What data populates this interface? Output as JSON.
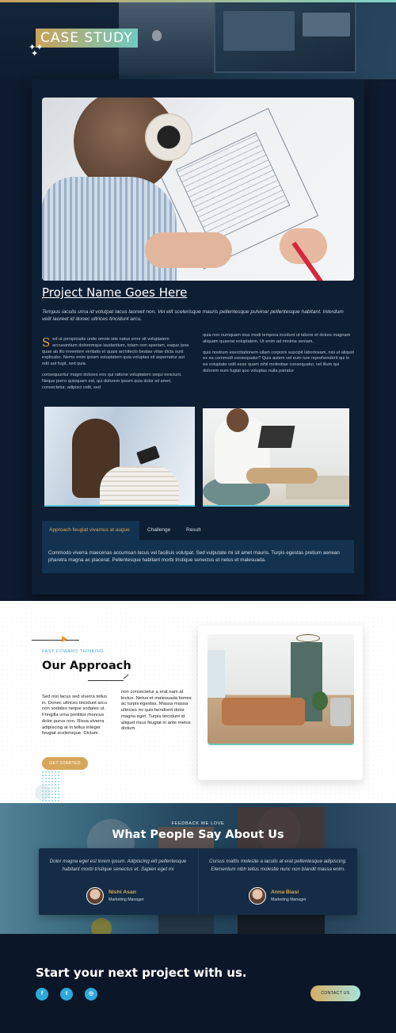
{
  "hero": {
    "title": "CASE STUDY",
    "sparkle": "+ +\n +"
  },
  "project": {
    "title": "Project Name Goes Here",
    "intro": "Tempus iaculis urna id volutpat lacus laoreet non. Vel elit scelerisque mauris pellentesque pulvinar pellentesque habitant. Interdum velit laoreet id donec ultrices tincidunt arcu.",
    "dropcap": "S",
    "left_p1": "ed ut perspiciatis unde omnis iste natus error sit voluptatem accusantium doloremque laudantium, totam rem aperiam, eaque ipsa quae ab illo inventore veritatis et quasi architecto beatae vitae dicta sunt explicabo. Nemo enim ipsam voluptatem quia voluptas sit aspernatur aut odit aut fugit, sed quia.",
    "left_p2": "consequuntur magni dolores eos qui ratione voluptatem sequi nesciunt. Neque porro quisquam est, qui dolorem ipsum quia dolor sit amet, consectetur, adipisci velit, sed",
    "right_p1": "quia non numquam eius modi tempora incidunt ut labore et dolore magnam aliquam quaerat voluptatem. Ut enim ad minima veniam,",
    "right_p2": "quis nostrum exercitationem ullam corporis suscipit laboriosam, nisi ut aliquid ex ea commodi consequatur? Quis autem vel eum iure reprehenderit qui in ea voluptate velit esse quam nihil molestiae consequatur, vel illum qui dolorem eum fugiat quo voluptas nulla pariatur",
    "tabs": [
      {
        "label": "Approach feugiat vivamus at augue"
      },
      {
        "label": "Challenge"
      },
      {
        "label": "Result"
      }
    ],
    "tab_content": "Commodo viverra maecenas accumsan lacus vel facilisis volutpat. Sed vulputate mi sit amet mauris. Turpis egestas pretium aenean pharetra magna ac placerat. Pellentesque habitant morbi tristique senectus et netus et malesuada."
  },
  "approach": {
    "kicker": "FAST FOWARD THINKING",
    "title": "Our Approach",
    "left_text": "Sed nisi lacus sed viverra tellus in. Donec ultrices tincidunt arcu non sodales neque sodales ut. Fringilla urna porttitor rhoncus dolor purus non. Risus viverra adipiscing at in tellus integer feugiat scelerisque. Dictum",
    "right_text": "non consectetur a erat nam at lectus. Netus et malesuada fames ac turpis egestas. Massa massa ultricies mi quis hendrerit dolor magna eget. Turpis tincidunt id aliquet risus feugiat in ante metus dictum.",
    "button": "GET STARTED"
  },
  "testimonials": {
    "kicker": "FEEDBACK WE LOVE",
    "title": "What People Say About Us",
    "items": [
      {
        "quote": "Dolor magna eget est lorem ipsum. Adipiscing elit pellentesque habitant morbi tristique senectus et. Sapien eget mi",
        "name": "Nishi Asan",
        "role": "Marketing Manager"
      },
      {
        "quote": "Cursus mattis molestie a iaculis at erat pellentesque adipiscing. Elementum nibh tellus molestie nunc non blandit massa enim.",
        "name": "Anna Biasi",
        "role": "Marketing Manager"
      }
    ]
  },
  "footer": {
    "title": "Start your next project with us.",
    "social": [
      {
        "icon": "facebook-icon",
        "glyph": "f"
      },
      {
        "icon": "twitter-icon",
        "glyph": "t"
      },
      {
        "icon": "instagram-icon",
        "glyph": "◎"
      }
    ],
    "contact_button": "CONTACT US"
  },
  "colors": {
    "accent_gold": "#d9a84e",
    "accent_teal": "#4fb0d6",
    "navy": "#0e1a2d"
  }
}
